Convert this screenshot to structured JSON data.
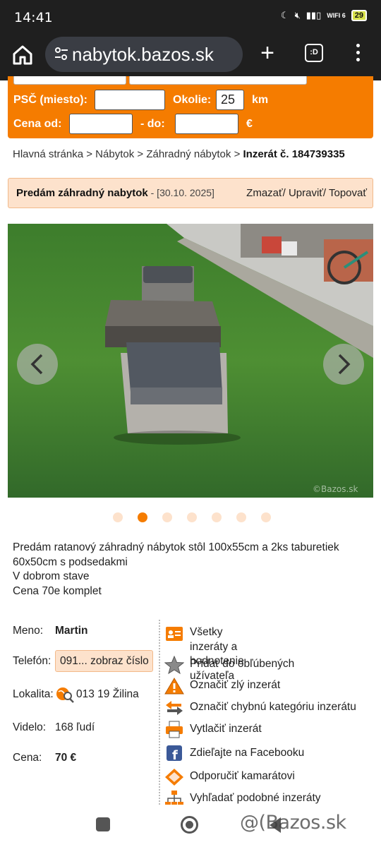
{
  "status_bar": {
    "time": "14:41",
    "wifi_label": "WIFI 6",
    "battery": "29"
  },
  "browser": {
    "url": "nabytok.bazos.sk",
    "tabs_label": ":D"
  },
  "search": {
    "psc_label": "PSČ  (miesto):",
    "psc_value": "",
    "okolie_label": "Okolie:",
    "okolie_value": "25",
    "km_label": "km",
    "cena_label": "Cena  od:",
    "cena_od_value": "",
    "do_label": "-  do:",
    "cena_do_value": "",
    "currency": "€"
  },
  "breadcrumb": {
    "items": [
      "Hlavná stránka",
      "Nábytok",
      "Záhradný nábytok"
    ],
    "separator": ">",
    "current": "Inzerát č. 184739335"
  },
  "listing": {
    "title": "Predám záhradný nabytok",
    "date": " - [30.10. 2025]",
    "actions": "Zmazať/ Upraviť/ Topovať",
    "photo_watermark": "©Bazos.sk",
    "photo_index": 2,
    "photo_count": 7,
    "description": [
      "Predám ratanový záhradný nábytok stôl 100x55cm a 2ks taburetiek 60x50cm s podsedakmi",
      "V dobrom stave",
      "Cena 70e komplet"
    ]
  },
  "seller": {
    "meno_label": "Meno:",
    "meno_value": "Martin",
    "telefon_label": "Telefón:",
    "telefon_button": "091... zobraz číslo",
    "lokalita_label": "Lokalita:",
    "lokalita_value": "013 19 Žilina",
    "videlo_label": "Videlo:",
    "videlo_value": "168 ľudí",
    "cena_label": "Cena:",
    "cena_value": "70 €"
  },
  "side_actions": [
    {
      "icon": "user-card-icon",
      "label": "Všetky inzeráty a hodnotenie\nužívateľa"
    },
    {
      "icon": "star-icon",
      "label": "Pridať do obľúbených"
    },
    {
      "icon": "warning-icon",
      "label": "Označiť zlý inzerát"
    },
    {
      "icon": "swap-arrows-icon",
      "label": "Označiť chybnú kategóriu inzerátu"
    },
    {
      "icon": "printer-icon",
      "label": "Vytlačiť inzerát"
    },
    {
      "icon": "facebook-icon",
      "label": "Zdieľajte na Facebooku"
    },
    {
      "icon": "recommend-icon",
      "label": "Odporučiť kamarátovi"
    },
    {
      "icon": "sitemap-icon",
      "label": "Vyhľadať podobné inzeráty"
    }
  ],
  "footer_watermark": "@(Bazos.sk",
  "colors": {
    "accent": "#f57c00",
    "accent_light": "#fde2cc",
    "toolbar": "#1f1f1f"
  }
}
